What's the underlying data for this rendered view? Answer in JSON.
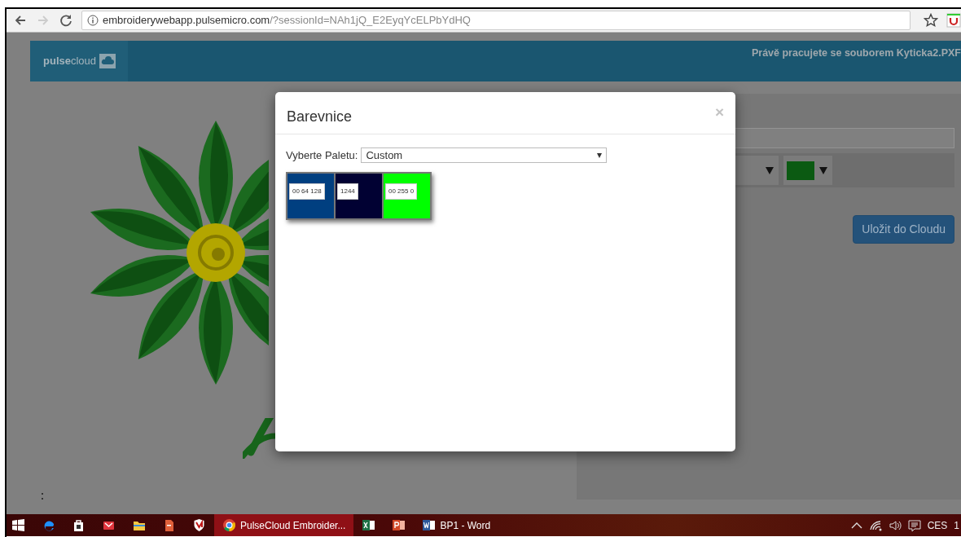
{
  "browser": {
    "forward_disabled": true,
    "url_domain": "embroiderywebapp.pulsemicro.com",
    "url_path": "/?sessionId=NAh1jQ_E2EyqYcELPbYdHQ"
  },
  "header": {
    "logo": "**pulse**cloud",
    "status_text": "Právě pracujete se souborem Kyticka2.PXF"
  },
  "side_panel": {
    "color_picker": {
      "color": "#0b5a12"
    },
    "save_button": "Uložit do Cloudu"
  },
  "modal": {
    "title": "Barevnice",
    "close": "×",
    "palette_label": "Vyberte Paletu:",
    "palette_value": "Custom",
    "swatches": [
      {
        "label": "00 64 128",
        "color": "#003f80"
      },
      {
        "label": "1244",
        "color": "#010133"
      },
      {
        "label": "00 255 0",
        "color": "#00ff00"
      }
    ]
  },
  "taskbar": {
    "items": [
      {
        "kind": "start",
        "selected": false
      },
      {
        "kind": "edge",
        "selected": false
      },
      {
        "kind": "store",
        "selected": false
      },
      {
        "kind": "mail",
        "selected": false
      },
      {
        "kind": "folder",
        "selected": false
      },
      {
        "kind": "document",
        "selected": false
      },
      {
        "kind": "shield",
        "selected": false
      },
      {
        "kind": "chrome",
        "label": "PulseCloud Embroider...",
        "selected": true
      },
      {
        "kind": "excel",
        "selected": false
      },
      {
        "kind": "powerpoint",
        "selected": false
      },
      {
        "kind": "word",
        "label": "BP1 - Word",
        "selected": false
      }
    ],
    "language": "CES",
    "clock": "1"
  }
}
